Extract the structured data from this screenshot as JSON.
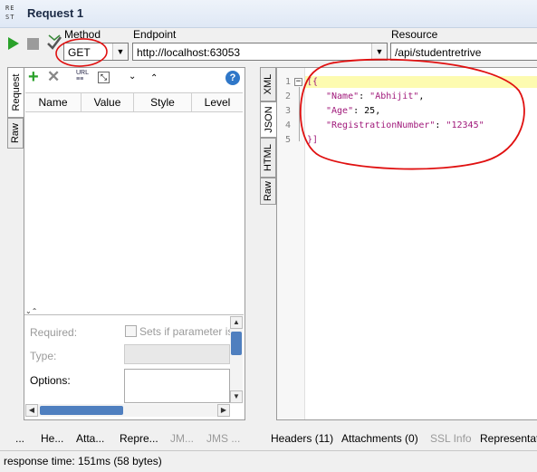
{
  "window": {
    "app_icon": "RE ST",
    "title": "Request 1"
  },
  "toolbar": {
    "method_label": "Method",
    "method_value": "GET",
    "endpoint_label": "Endpoint",
    "endpoint_value": "http://localhost:63053",
    "resource_label": "Resource",
    "resource_value": "/api/studentretrive"
  },
  "left_tabs": [
    "Request",
    "Raw"
  ],
  "params_toolbar": {
    "url_icon_label": "URL"
  },
  "params_table": {
    "columns": [
      "Name",
      "Value",
      "Style",
      "Level"
    ]
  },
  "param_details": {
    "required_label": "Required:",
    "required_checkbox_label": "Sets if parameter is",
    "type_label": "Type:",
    "options_label": "Options:"
  },
  "left_bottom_tabs": [
    "...",
    "He...",
    "Atta...",
    "Repre...",
    "JM...",
    "JMS ..."
  ],
  "right_tabs": [
    "XML",
    "JSON",
    "HTML",
    "Raw"
  ],
  "editor": {
    "lines": [
      {
        "n": "1",
        "text": "[{"
      },
      {
        "n": "2",
        "key": "\"Name\"",
        "sep": ": ",
        "val": "\"Abhijit\"",
        "end": ","
      },
      {
        "n": "3",
        "key": "\"Age\"",
        "sep": ": ",
        "val": "25",
        "end": ","
      },
      {
        "n": "4",
        "key": "\"RegistrationNumber\"",
        "sep": ": ",
        "val": "\"12345\"",
        "end": ""
      },
      {
        "n": "5",
        "text": "}]"
      }
    ]
  },
  "right_bottom_tabs": [
    "Headers (11)",
    "Attachments (0)",
    "SSL Info",
    "Representat"
  ],
  "status": {
    "text": "response time: 151ms (58 bytes)"
  },
  "colors": {
    "annotation_red": "#e01010",
    "run_green": "#2aa12a",
    "json_key": "#a0197a",
    "current_line": "#fdfbb0"
  }
}
